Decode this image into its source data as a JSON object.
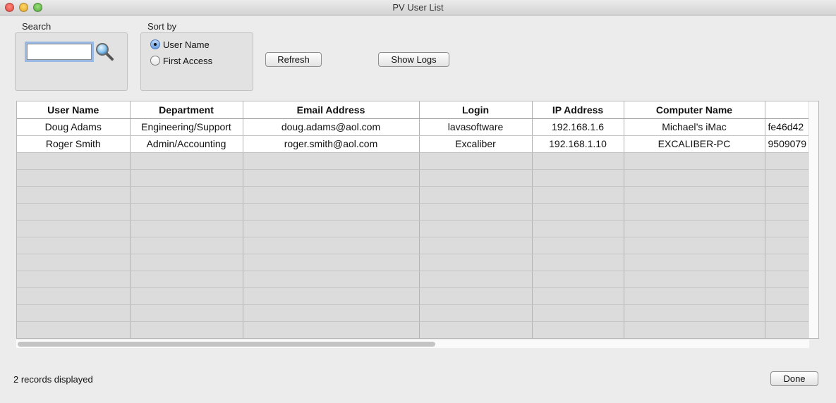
{
  "window": {
    "title": "PV User List"
  },
  "search": {
    "label": "Search",
    "value": ""
  },
  "sort": {
    "label": "Sort by",
    "options": [
      "User Name",
      "First Access"
    ],
    "selected": "User Name"
  },
  "toolbar": {
    "refresh_label": "Refresh",
    "show_logs_label": "Show Logs"
  },
  "table": {
    "columns": [
      "User Name",
      "Department",
      "Email Address",
      "Login",
      "IP Address",
      "Computer Name",
      ""
    ],
    "rows": [
      [
        "Doug Adams",
        "Engineering/Support",
        "doug.adams@aol.com",
        "lavasoftware",
        "192.168.1.6",
        "Michael’s iMac",
        "fe46d42"
      ],
      [
        "Roger Smith",
        "Admin/Accounting",
        "roger.smith@aol.com",
        "Excaliber",
        "192.168.1.10",
        "EXCALIBER-PC",
        "9509079"
      ]
    ]
  },
  "footer": {
    "status": "2 records displayed",
    "done_label": "Done"
  }
}
